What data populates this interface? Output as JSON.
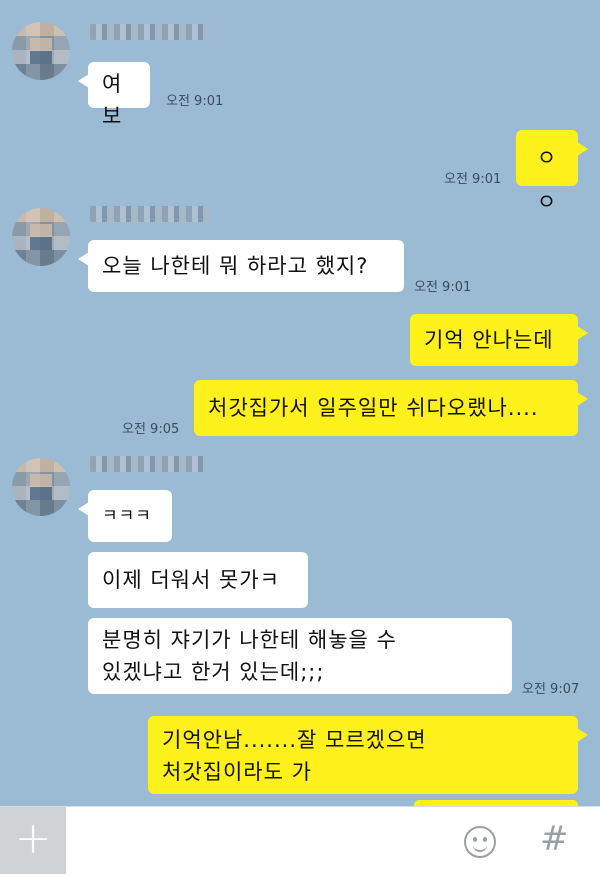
{
  "chat": {
    "messages": [
      {
        "text": "여보",
        "time": "오전 9:01"
      },
      {
        "text": "ㅇㅇ",
        "time": "오전 9:01"
      },
      {
        "text": "오늘 나한테 뭐 하라고 했지?",
        "time": "오전 9:01"
      },
      {
        "text": "기억 안나는데"
      },
      {
        "text": "처갓집가서 일주일만 쉬다오랬나....",
        "time": "오전 9:05"
      },
      {
        "text": "ㅋㅋㅋ"
      },
      {
        "text": "이제 더워서 못가ㅋ"
      },
      {
        "text": "분명히 쟈기가 나한테 해놓을 수\n있겠냐고 한거 있는데;;;",
        "time": "오전 9:07"
      },
      {
        "text": "기억안남.......잘 모르겠으면\n처갓집이라도 가"
      }
    ]
  },
  "input_bar": {
    "plus_label": "+",
    "hash_label": "#"
  },
  "colors": {
    "background": "#9bbbd4",
    "my_bubble": "#fef01b",
    "their_bubble": "#ffffff"
  },
  "icons": {
    "attach": "plus-icon",
    "emoticon": "smiley-icon",
    "hash": "hash-icon"
  }
}
